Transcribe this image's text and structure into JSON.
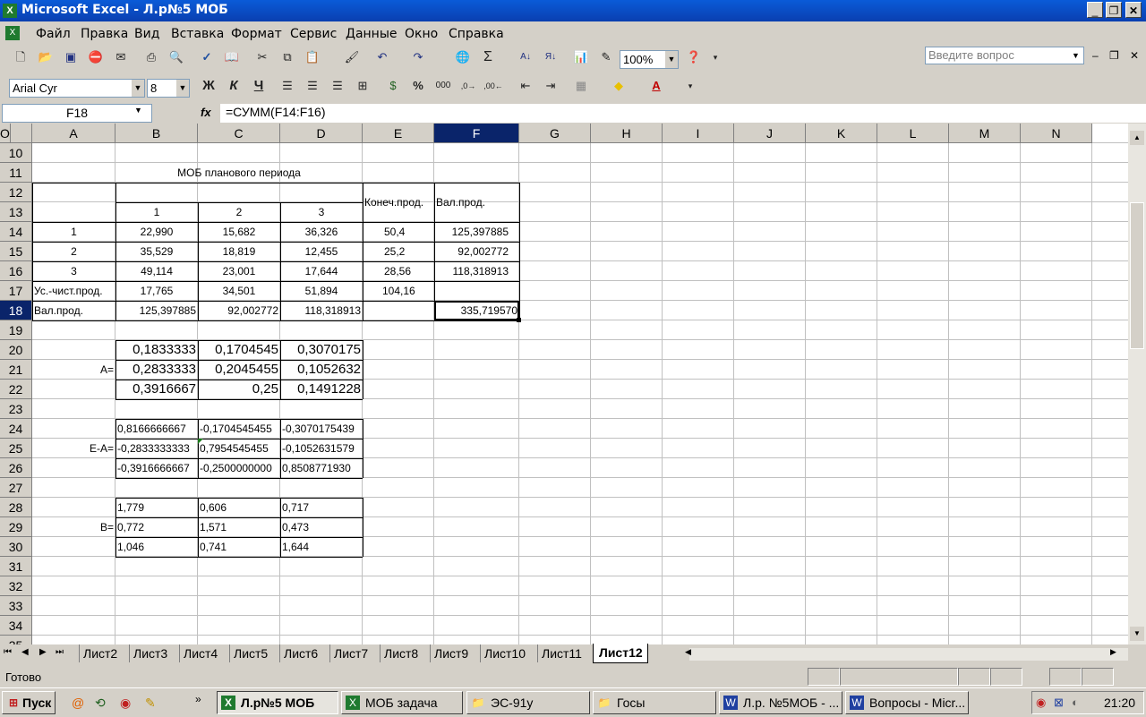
{
  "window": {
    "title": "Microsoft Excel - Л.р№5 МОБ",
    "app_icon": "excel-icon"
  },
  "menu": {
    "items": [
      "Файл",
      "Правка",
      "Вид",
      "Вставка",
      "Формат",
      "Сервис",
      "Данные",
      "Окно",
      "Справка"
    ],
    "help_placeholder": "Введите вопрос"
  },
  "toolbar": {
    "zoom": "100%",
    "font_name": "Arial Cyr",
    "font_size": "8"
  },
  "formula_bar": {
    "name_box": "F18",
    "fx": "fx",
    "formula": "=СУММ(F14:F16)"
  },
  "columns": [
    "A",
    "B",
    "C",
    "D",
    "E",
    "F",
    "G",
    "H",
    "I",
    "J",
    "K",
    "L",
    "M",
    "N",
    "O"
  ],
  "rows": [
    "10",
    "11",
    "12",
    "13",
    "14",
    "15",
    "16",
    "17",
    "18",
    "19",
    "20",
    "21",
    "22",
    "23",
    "24",
    "25",
    "26",
    "27",
    "28",
    "29",
    "30",
    "31",
    "32",
    "33",
    "34",
    "35"
  ],
  "selected": {
    "column": "F",
    "row": "18"
  },
  "sheet": {
    "r11_title": "МОБ планового периода",
    "r12_konech": "Конеч.прод.",
    "r12_val": "Вал.прод.",
    "r13": [
      "1",
      "2",
      "3"
    ],
    "r14": [
      "1",
      "22,990",
      "15,682",
      "36,326",
      "50,4",
      "125,397885"
    ],
    "r15": [
      "2",
      "35,529",
      "18,819",
      "12,455",
      "25,2",
      "92,002772"
    ],
    "r16": [
      "3",
      "49,114",
      "23,001",
      "17,644",
      "28,56",
      "118,318913"
    ],
    "r17": [
      "Ус.-чист.прод.",
      "17,765",
      "34,501",
      "51,894",
      "104,16"
    ],
    "r18": [
      "Вал.прод.",
      "125,397885",
      "92,002772",
      "118,318913",
      "",
      "335,719570"
    ],
    "a_label": "A=",
    "a_matrix": [
      [
        "0,1833333",
        "0,1704545",
        "0,3070175"
      ],
      [
        "0,2833333",
        "0,2045455",
        "0,1052632"
      ],
      [
        "0,3916667",
        "0,25",
        "0,1491228"
      ]
    ],
    "ea_label": "E-A=",
    "ea_matrix": [
      [
        "0,8166666667",
        "-0,1704545455",
        "-0,3070175439"
      ],
      [
        "-0,2833333333",
        "0,7954545455",
        "-0,1052631579"
      ],
      [
        "-0,3916666667",
        "-0,2500000000",
        "0,8508771930"
      ]
    ],
    "b_label": "B=",
    "b_matrix": [
      [
        "1,779",
        "0,606",
        "0,717"
      ],
      [
        "0,772",
        "1,571",
        "0,473"
      ],
      [
        "1,046",
        "0,741",
        "1,644"
      ]
    ]
  },
  "sheet_tabs": [
    "Лист2",
    "Лист3",
    "Лист4",
    "Лист5",
    "Лист6",
    "Лист7",
    "Лист8",
    "Лист9",
    "Лист10",
    "Лист11",
    "Лист12"
  ],
  "active_tab": "Лист12",
  "status": "Готово",
  "taskbar": {
    "start": "Пуск",
    "tasks": [
      "Л.р№5 МОБ",
      "МОБ задача",
      "ЭС-91у",
      "Госы",
      "Л.р. №5МОБ - ...",
      "Вопросы - Micr..."
    ],
    "clock": "21:20"
  }
}
